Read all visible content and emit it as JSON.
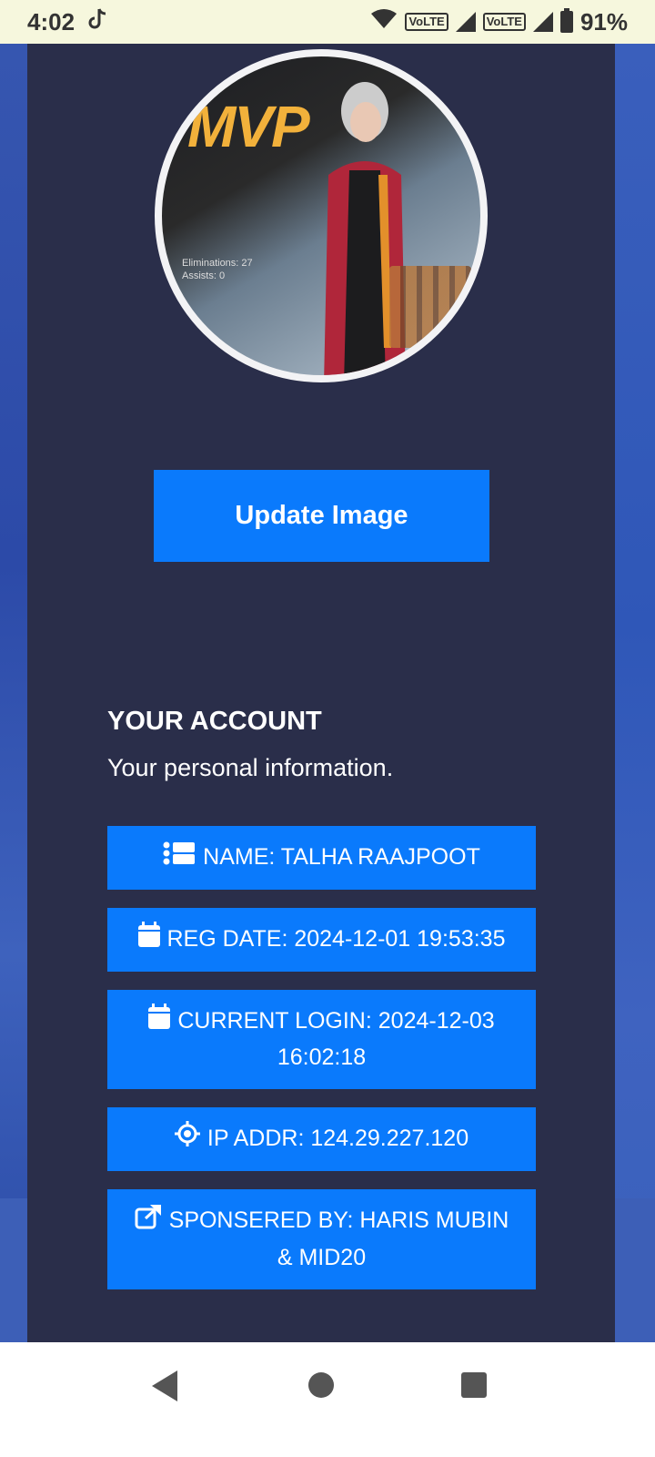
{
  "status_bar": {
    "time": "4:02",
    "volte1": "VoLTE",
    "volte2": "VoLTE",
    "battery": "91%"
  },
  "profile": {
    "update_label": "Update Image",
    "mvp_text": "MVP",
    "stats_line1": "Eliminations: 27",
    "stats_line2": "Assists: 0"
  },
  "account": {
    "title": "YOUR ACCOUNT",
    "subtitle": "Your personal information.",
    "name": "NAME: TALHA RAAJPOOT",
    "reg_date": "REG DATE: 2024-12-01 19:53:35",
    "current_login": "CURRENT LOGIN: 2024-12-03 16:02:18",
    "ip_addr": "IP ADDR: 124.29.227.120",
    "sponsored": "SPONSERED BY: HARIS MUBIN & MID20"
  },
  "colors": {
    "accent": "#0a7afc",
    "panel": "#2a2e4a",
    "status_bg": "#f6f7dd"
  }
}
